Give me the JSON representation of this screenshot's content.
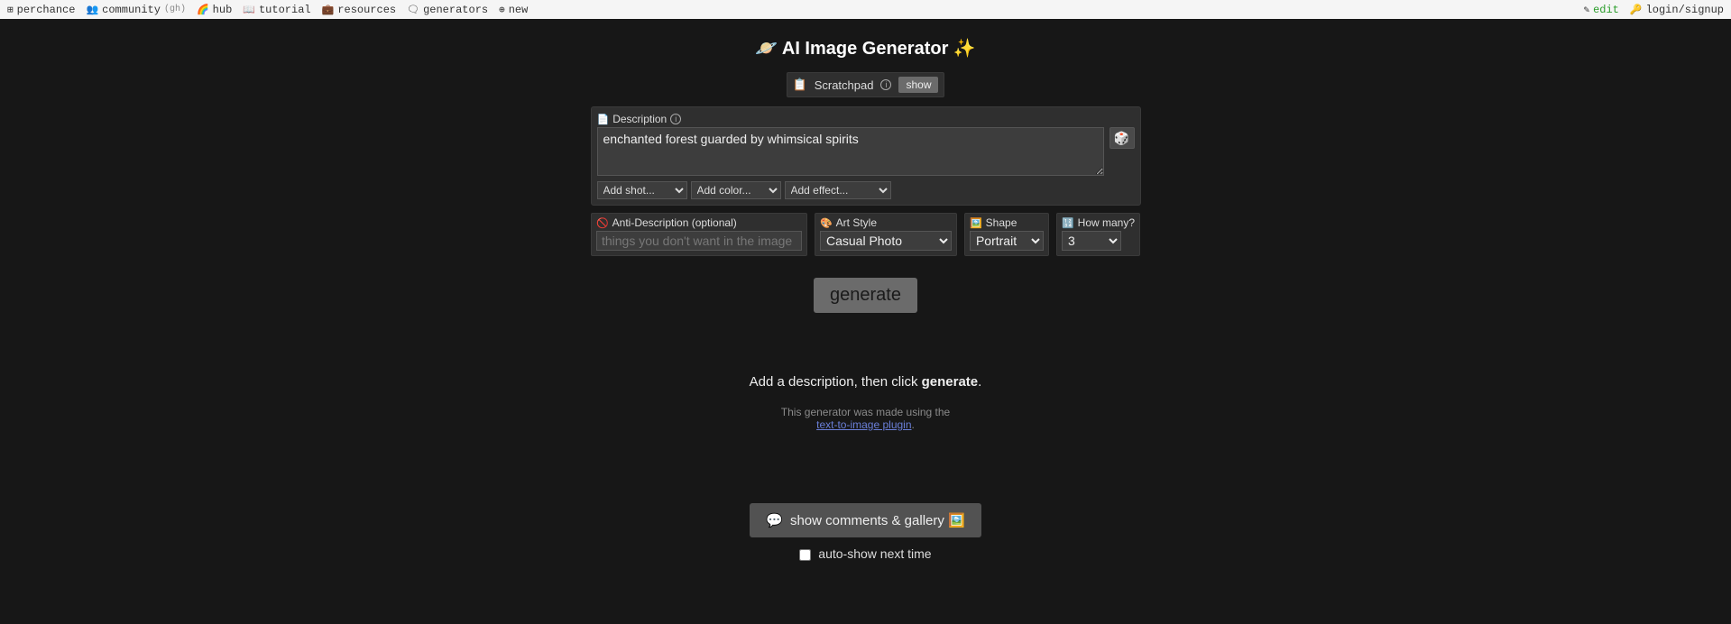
{
  "topbar": {
    "perchance": "perchance",
    "community": "community",
    "community_gh": "(gh)",
    "hub": "hub",
    "tutorial": "tutorial",
    "resources": "resources",
    "generators": "generators",
    "new": "new",
    "edit": "edit",
    "login": "login/signup"
  },
  "title": "🪐 AI Image Generator ✨",
  "scratchpad": {
    "label": "Scratchpad",
    "show": "show"
  },
  "description": {
    "label": "Description",
    "value": "enchanted forest guarded by whimsical spirits",
    "add_shot": "Add shot...",
    "add_color": "Add color...",
    "add_effect": "Add effect..."
  },
  "anti": {
    "label": "Anti-Description (optional)",
    "placeholder_pre": "things you ",
    "placeholder_em": "don't",
    "placeholder_post": " want in the image",
    "placeholder_full": "things you don't want in the image"
  },
  "art": {
    "label": "Art Style",
    "value": "Casual Photo"
  },
  "shape": {
    "label": "Shape",
    "value": "Portrait"
  },
  "count": {
    "label": "How many?",
    "value": "3"
  },
  "generate": "generate",
  "hint_pre": "Add a description, then click ",
  "hint_bold": "generate",
  "hint_post": ".",
  "made_with": "This generator was made using the",
  "plugin_link": "text-to-image plugin",
  "comments_btn": "show comments & gallery 🖼️",
  "autoshow": "auto-show next time"
}
